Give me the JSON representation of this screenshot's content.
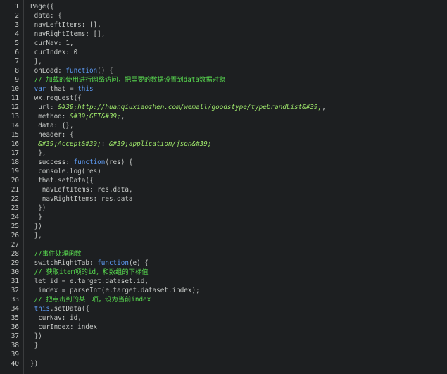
{
  "editor": {
    "lines": [
      {
        "n": "1",
        "t": [
          {
            "c": "plain",
            "v": "Page({"
          }
        ]
      },
      {
        "n": "2",
        "t": [
          {
            "c": "plain",
            "v": " data: {"
          }
        ]
      },
      {
        "n": "3",
        "t": [
          {
            "c": "plain",
            "v": " navLeftItems: [],"
          }
        ]
      },
      {
        "n": "4",
        "t": [
          {
            "c": "plain",
            "v": " navRightItems: [],"
          }
        ]
      },
      {
        "n": "5",
        "t": [
          {
            "c": "plain",
            "v": " curNav: 1,"
          }
        ]
      },
      {
        "n": "6",
        "t": [
          {
            "c": "plain",
            "v": " curIndex: 0"
          }
        ]
      },
      {
        "n": "7",
        "t": [
          {
            "c": "plain",
            "v": " },"
          }
        ]
      },
      {
        "n": "8",
        "t": [
          {
            "c": "plain",
            "v": " onLoad: "
          },
          {
            "c": "kw",
            "v": "function"
          },
          {
            "c": "plain",
            "v": "() {"
          }
        ]
      },
      {
        "n": "9",
        "t": [
          {
            "c": "cm",
            "v": " // 加载的使用进行网络访问，把需要的数据设置到data数据对象"
          }
        ]
      },
      {
        "n": "10",
        "t": [
          {
            "c": "plain",
            "v": " "
          },
          {
            "c": "kw",
            "v": "var"
          },
          {
            "c": "plain",
            "v": " that = "
          },
          {
            "c": "kw",
            "v": "this"
          }
        ]
      },
      {
        "n": "11",
        "t": [
          {
            "c": "plain",
            "v": " wx.request({"
          }
        ]
      },
      {
        "n": "12",
        "t": [
          {
            "c": "plain",
            "v": "  url: "
          },
          {
            "c": "str",
            "v": "&#39;http://huanqiuxiaozhen.com/wemall/goodstype/typebrandList&#39;"
          },
          {
            "c": "plain",
            "v": ","
          }
        ]
      },
      {
        "n": "13",
        "t": [
          {
            "c": "plain",
            "v": "  method: "
          },
          {
            "c": "str",
            "v": "&#39;GET&#39;"
          },
          {
            "c": "plain",
            "v": ","
          }
        ]
      },
      {
        "n": "14",
        "t": [
          {
            "c": "plain",
            "v": "  data: {},"
          }
        ]
      },
      {
        "n": "15",
        "t": [
          {
            "c": "plain",
            "v": "  header: {"
          }
        ]
      },
      {
        "n": "16",
        "t": [
          {
            "c": "str",
            "v": "  &#39;Accept&#39;"
          },
          {
            "c": "plain",
            "v": ": "
          },
          {
            "c": "str",
            "v": "&#39;application/json&#39;"
          }
        ]
      },
      {
        "n": "17",
        "t": [
          {
            "c": "plain",
            "v": "  },"
          }
        ]
      },
      {
        "n": "18",
        "t": [
          {
            "c": "plain",
            "v": "  success: "
          },
          {
            "c": "kw",
            "v": "function"
          },
          {
            "c": "plain",
            "v": "(res) {"
          }
        ]
      },
      {
        "n": "19",
        "t": [
          {
            "c": "plain",
            "v": "  console.log(res)"
          }
        ]
      },
      {
        "n": "20",
        "t": [
          {
            "c": "plain",
            "v": "  that.setData({"
          }
        ]
      },
      {
        "n": "21",
        "t": [
          {
            "c": "plain",
            "v": "   navLeftItems: res.data,"
          }
        ]
      },
      {
        "n": "22",
        "t": [
          {
            "c": "plain",
            "v": "   navRightItems: res.data"
          }
        ]
      },
      {
        "n": "23",
        "t": [
          {
            "c": "plain",
            "v": "  })"
          }
        ]
      },
      {
        "n": "24",
        "t": [
          {
            "c": "plain",
            "v": "  }"
          }
        ]
      },
      {
        "n": "25",
        "t": [
          {
            "c": "plain",
            "v": " })"
          }
        ]
      },
      {
        "n": "26",
        "t": [
          {
            "c": "plain",
            "v": " },"
          }
        ]
      },
      {
        "n": "27",
        "t": []
      },
      {
        "n": "28",
        "t": [
          {
            "c": "cm",
            "v": " //事件处理函数"
          }
        ]
      },
      {
        "n": "29",
        "t": [
          {
            "c": "plain",
            "v": " switchRightTab: "
          },
          {
            "c": "kw",
            "v": "function"
          },
          {
            "c": "plain",
            "v": "(e) {"
          }
        ]
      },
      {
        "n": "30",
        "t": [
          {
            "c": "cm",
            "v": " // 获取item项的id，和数组的下标值"
          }
        ]
      },
      {
        "n": "31",
        "t": [
          {
            "c": "plain",
            "v": " let id = e.target.dataset.id,"
          }
        ]
      },
      {
        "n": "32",
        "t": [
          {
            "c": "plain",
            "v": "  index = parseInt(e.target.dataset.index);"
          }
        ]
      },
      {
        "n": "33",
        "t": [
          {
            "c": "cm",
            "v": " // 把点击到的某一项，设为当前index"
          }
        ]
      },
      {
        "n": "34",
        "t": [
          {
            "c": "plain",
            "v": " "
          },
          {
            "c": "kw",
            "v": "this"
          },
          {
            "c": "plain",
            "v": ".setData({"
          }
        ]
      },
      {
        "n": "35",
        "t": [
          {
            "c": "plain",
            "v": "  curNav: id,"
          }
        ]
      },
      {
        "n": "36",
        "t": [
          {
            "c": "plain",
            "v": "  curIndex: index"
          }
        ]
      },
      {
        "n": "37",
        "t": [
          {
            "c": "plain",
            "v": " })"
          }
        ]
      },
      {
        "n": "38",
        "t": [
          {
            "c": "plain",
            "v": " }"
          }
        ]
      },
      {
        "n": "39",
        "t": []
      },
      {
        "n": "40",
        "t": [
          {
            "c": "plain",
            "v": "})"
          }
        ]
      }
    ]
  },
  "colors": {
    "background": "#1d1f21",
    "text": "#c5c8c6",
    "keyword": "#5e9cf5",
    "comment": "#58d84f",
    "string": "#9fe86b"
  }
}
